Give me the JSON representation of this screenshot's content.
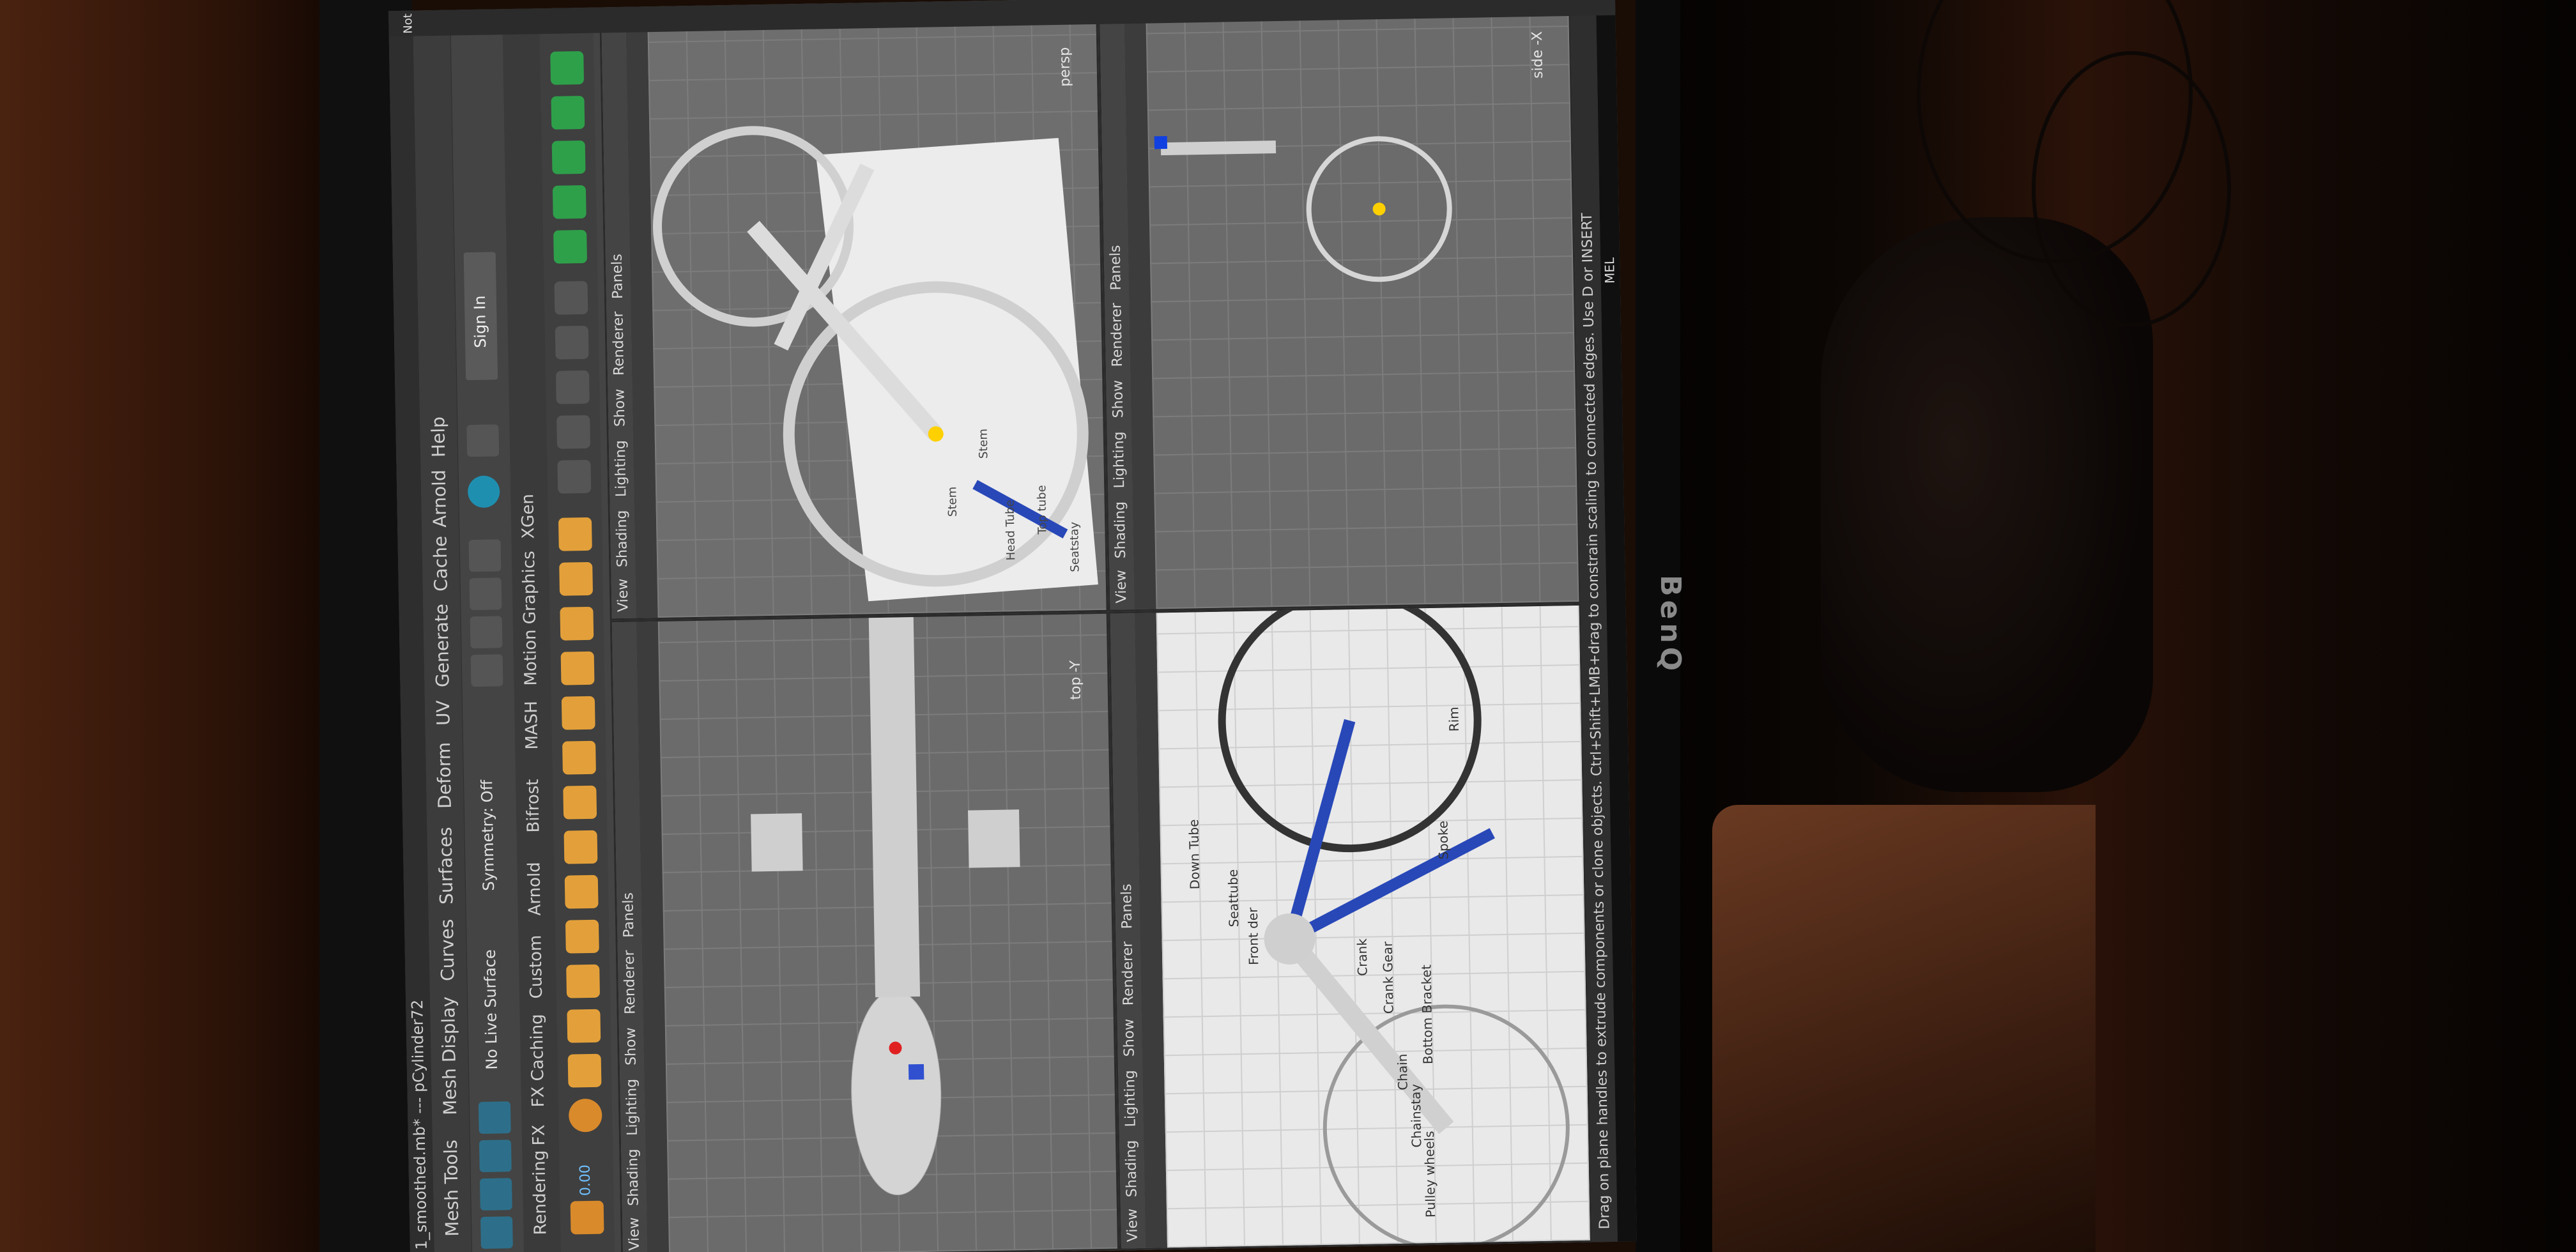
{
  "maya": {
    "window_title": "1_smoothed.mb* --- pCylinder72",
    "menu": [
      "Mesh Tools",
      "Mesh Display",
      "Curves",
      "Surfaces",
      "Deform",
      "UV",
      "Generate",
      "Cache",
      "Arnold",
      "Help"
    ],
    "shelf_tabs": [
      "Rendering",
      "FX",
      "FX Caching",
      "Custom",
      "Arnold",
      "Bifrost",
      "MASH",
      "Motion Graphics",
      "XGen"
    ],
    "live_surface": "No Live Surface",
    "symmetry": "Symmetry: Off",
    "sign_in": "Sign In",
    "coord": "0.00",
    "panel_menu": [
      "View",
      "Shading",
      "Lighting",
      "Show",
      "Renderer",
      "Panels"
    ],
    "cameras": {
      "persp": "persp",
      "top": "top -Y",
      "side": "side -X"
    },
    "ref_labels": [
      "Down Tube",
      "Seattube",
      "Front der",
      "Crank",
      "Crank Gear",
      "Bottom Bracket",
      "Chain",
      "Chainstay",
      "Pulley wheels",
      "Spoke",
      "Rim"
    ],
    "persp_labels": [
      "Head Tube",
      "Top tube",
      "Seatstay",
      "Stem",
      "Stem"
    ],
    "status_text": "Drag on plane handles to extrude components or clone objects. Ctrl+Shift+LMB+drag to constrain scaling to connected edges. Use D or INSERT",
    "mel": "MEL",
    "note": "Not",
    "brand": "BenQ"
  }
}
